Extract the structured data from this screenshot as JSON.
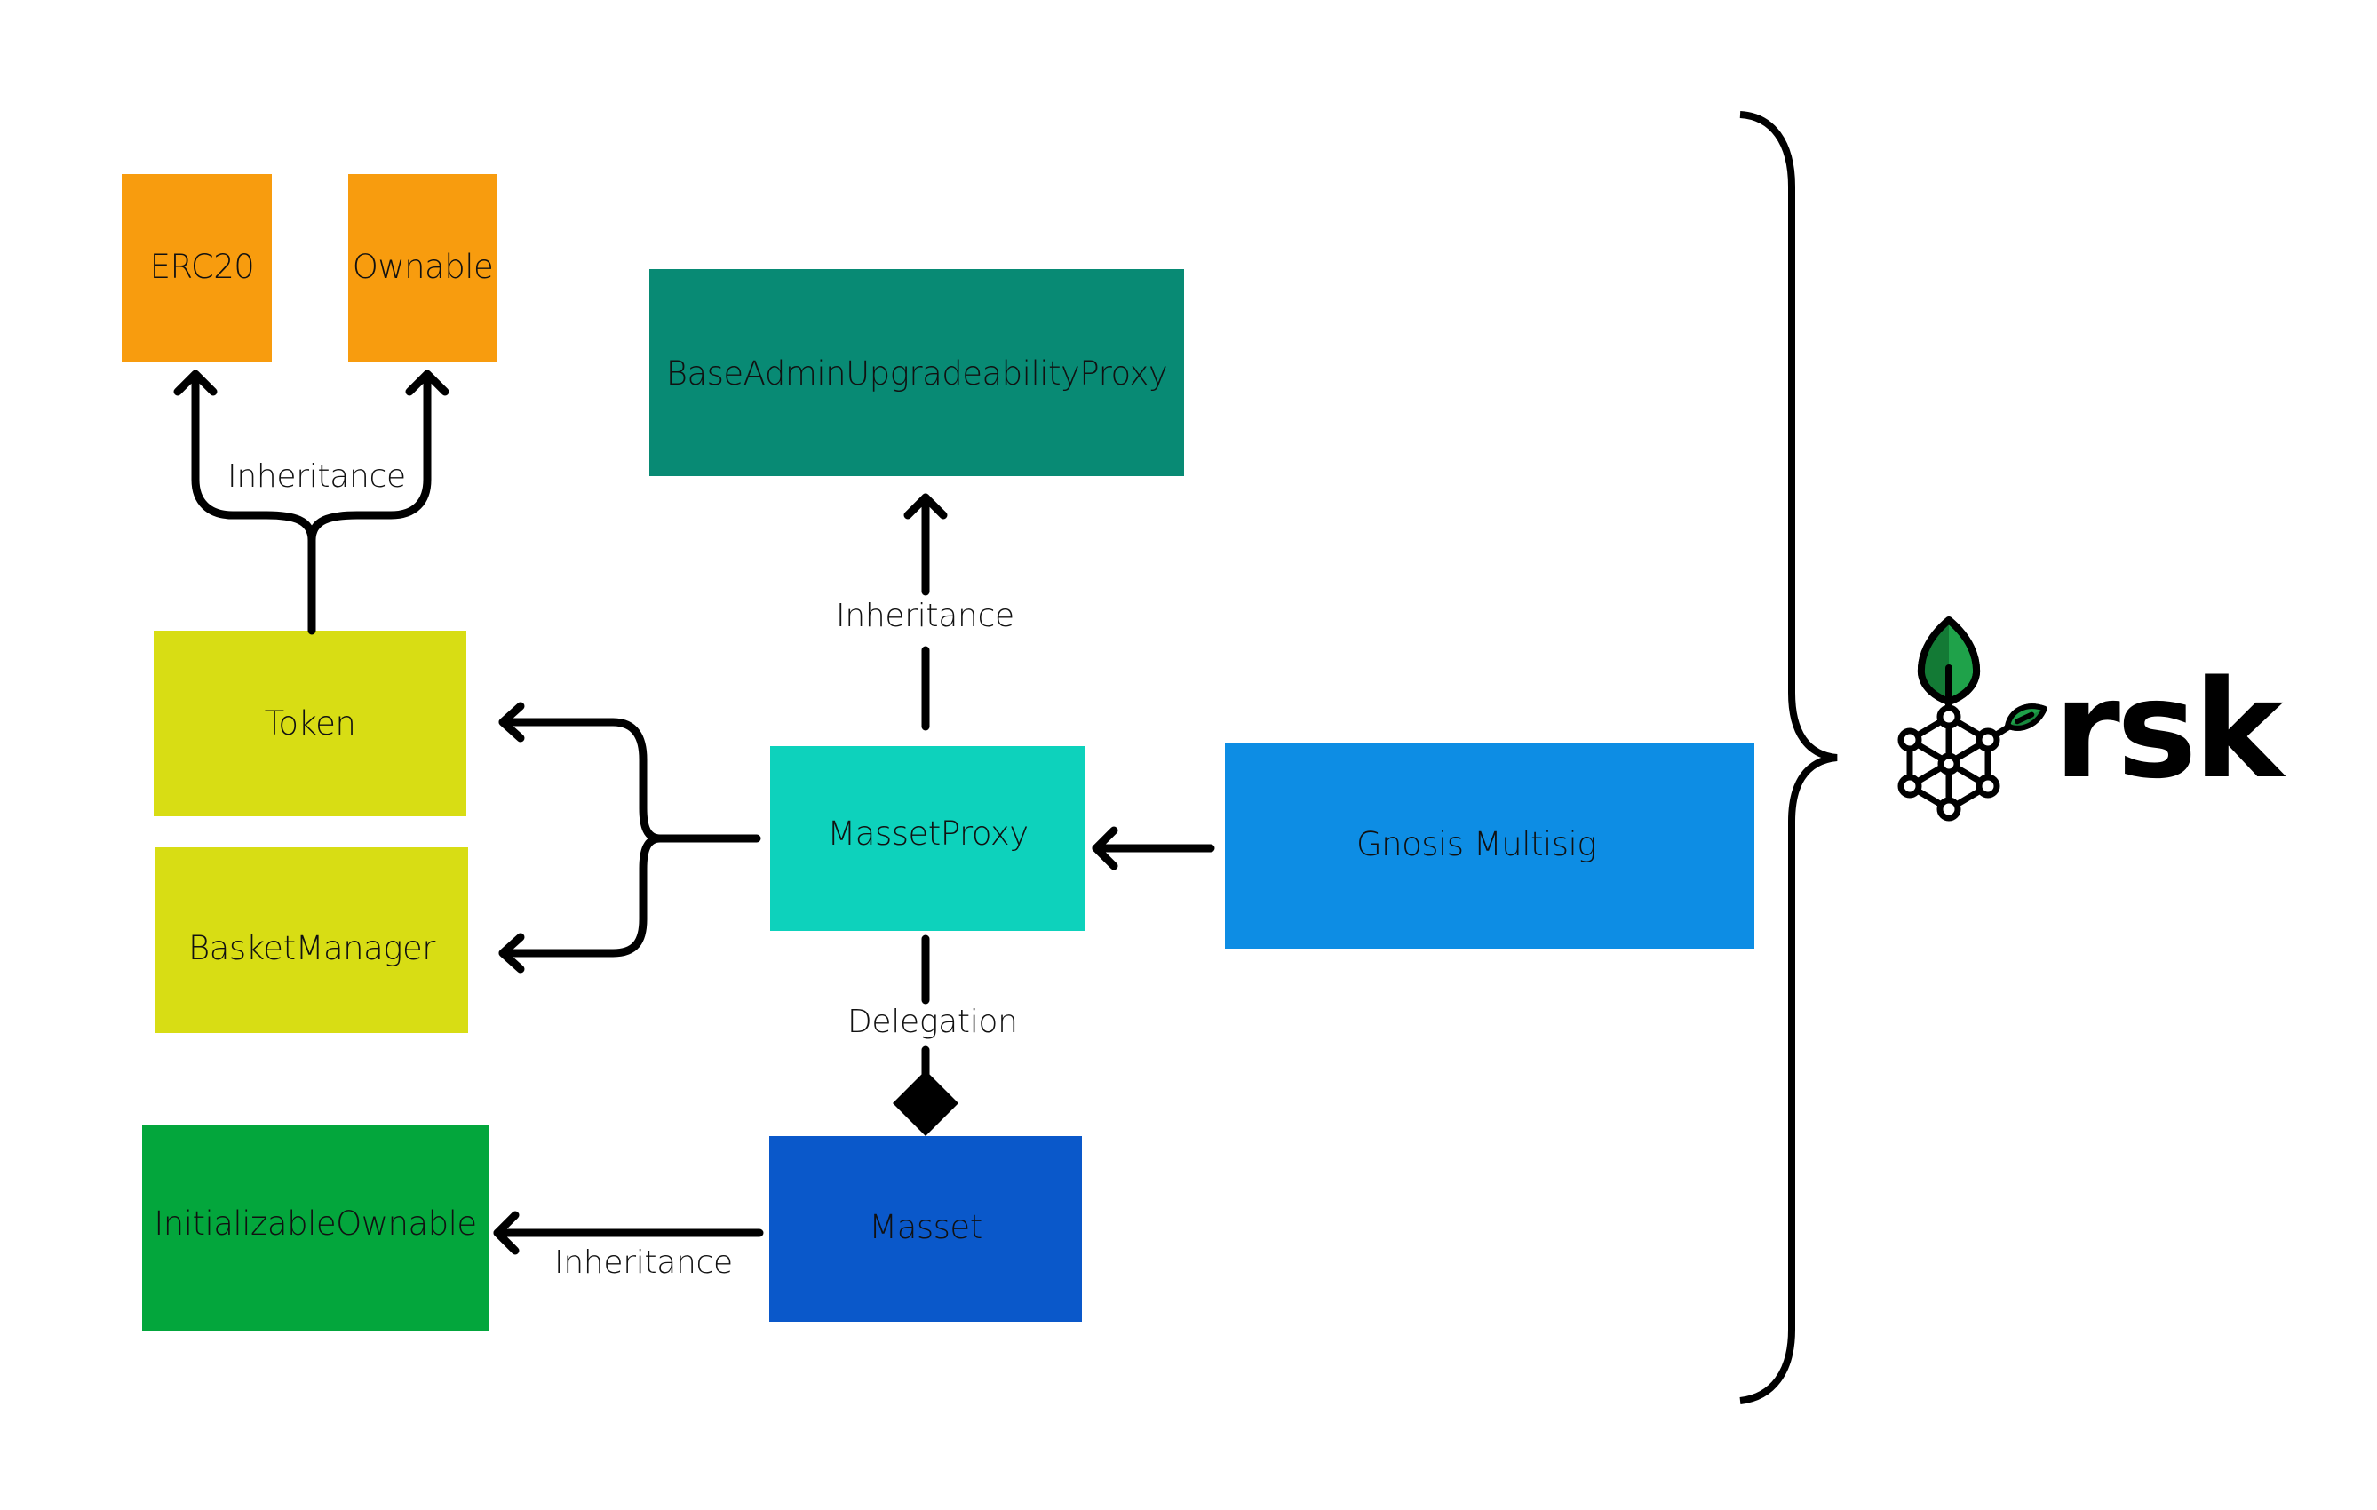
{
  "diagram": {
    "nodes": {
      "erc20": {
        "label": "ERC20",
        "color": "#F89C0E"
      },
      "ownable": {
        "label": "Ownable",
        "color": "#F89C0E"
      },
      "base_admin_upgradeability_proxy": {
        "label": "BaseAdminUpgradeabilityProxy",
        "color": "#088A74"
      },
      "token": {
        "label": "Token",
        "color": "#D8DD14"
      },
      "basket_manager": {
        "label": "BasketManager",
        "color": "#D8DD14"
      },
      "masset_proxy": {
        "label": "MassetProxy",
        "color": "#0DD2BC"
      },
      "gnosis_multisig": {
        "label": "Gnosis Multisig",
        "color": "#0D8DE4"
      },
      "initializable_ownable": {
        "label": "InitializableOwnable",
        "color": "#03A63C"
      },
      "masset": {
        "label": "Masset",
        "color": "#0A58CA"
      }
    },
    "edges": [
      {
        "from": "token",
        "to": [
          "erc20",
          "ownable"
        ],
        "type": "inheritance",
        "label": "Inheritance"
      },
      {
        "from": "masset_proxy",
        "to": [
          "base_admin_upgradeability_proxy"
        ],
        "type": "inheritance",
        "label": "Inheritance"
      },
      {
        "from": "masset_proxy",
        "to": [
          "token",
          "basket_manager"
        ],
        "type": "association",
        "label": ""
      },
      {
        "from": "gnosis_multisig",
        "to": [
          "masset_proxy"
        ],
        "type": "association",
        "label": ""
      },
      {
        "from": "masset_proxy",
        "to": [
          "masset"
        ],
        "type": "delegation",
        "label": "Delegation"
      },
      {
        "from": "masset",
        "to": [
          "initializable_ownable"
        ],
        "type": "inheritance",
        "label": "Inheritance"
      }
    ],
    "labels": {
      "token_inheritance": "Inheritance",
      "proxy_inheritance": "Inheritance",
      "delegation": "Delegation",
      "masset_inheritance": "Inheritance"
    },
    "group_brace": {
      "encloses": "all",
      "platform": "rsk"
    },
    "logo": {
      "text": "rsk",
      "icon": "rsk-tree-network-icon",
      "leaf_color": "#1FA24A",
      "leaf_dark_color": "#137A35"
    }
  }
}
